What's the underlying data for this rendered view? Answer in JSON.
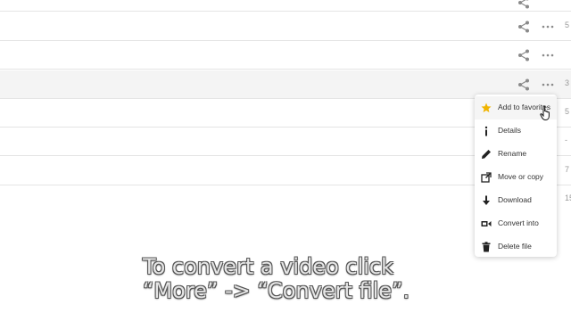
{
  "rows": [
    {
      "number": ""
    },
    {
      "number": "5"
    },
    {
      "number": ""
    },
    {
      "number": "3"
    },
    {
      "number": "5"
    },
    {
      "number": "-"
    },
    {
      "number": "7"
    },
    {
      "number": "15"
    }
  ],
  "context_menu": {
    "items": [
      {
        "label": "Add to favorites",
        "icon": "star-icon"
      },
      {
        "label": "Details",
        "icon": "info-icon"
      },
      {
        "label": "Rename",
        "icon": "pencil-icon"
      },
      {
        "label": "Move or copy",
        "icon": "move-copy-icon"
      },
      {
        "label": "Download",
        "icon": "download-arrow-icon"
      },
      {
        "label": "Convert into",
        "icon": "convert-icon"
      },
      {
        "label": "Delete file",
        "icon": "trash-icon"
      }
    ]
  },
  "caption": {
    "line1": "To convert a video click",
    "line2": "“More” -> “Convert file”."
  },
  "colors": {
    "star": "#f0b400",
    "hover_row": "#f4f4f4",
    "icon_gray": "#8a8a8a"
  }
}
